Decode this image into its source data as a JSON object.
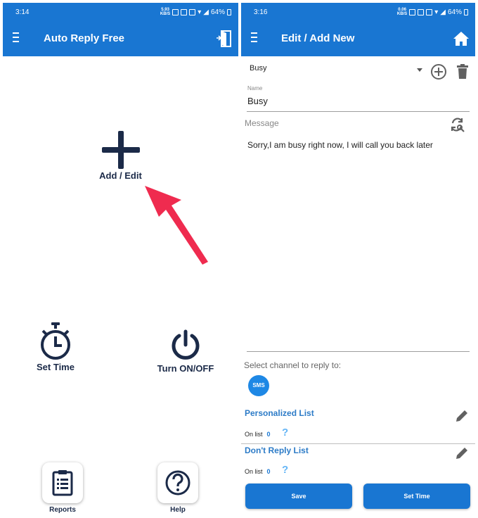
{
  "left": {
    "status": {
      "time": "3:14",
      "speed": "5.93",
      "speed_unit": "KB/S",
      "battery": "64%"
    },
    "appbar": {
      "title": "Auto Reply Free"
    },
    "add_edit_label": "Add / Edit",
    "set_time_label": "Set Time",
    "turn_on_off_label": "Turn ON/OFF",
    "reports_label": "Reports",
    "help_label": "Help"
  },
  "right": {
    "status": {
      "time": "3:16",
      "speed": "0.06",
      "speed_unit": "KB/S",
      "battery": "64%"
    },
    "appbar": {
      "title": "Edit / Add New"
    },
    "dropdown_value": "Busy",
    "name_label": "Name",
    "name_value": "Busy",
    "message_label": "Message",
    "message_value": "Sorry,I am busy right now, I will call you back later",
    "select_channel_label": "Select channel to reply to:",
    "sms_label": "SMS",
    "personalized_list": {
      "title": "Personalized List",
      "on_list_label": "On list",
      "count": "0",
      "help": "?"
    },
    "dont_reply_list": {
      "title": "Don't Reply List",
      "on_list_label": "On list",
      "count": "0",
      "help": "?"
    },
    "save_label": "Save",
    "set_time_button_label": "Set Time"
  },
  "colors": {
    "primary": "#1976d2",
    "dark_icon": "#1b2a48",
    "accent_arrow": "#ef2b4f",
    "link_blue": "#2c7bc7"
  }
}
